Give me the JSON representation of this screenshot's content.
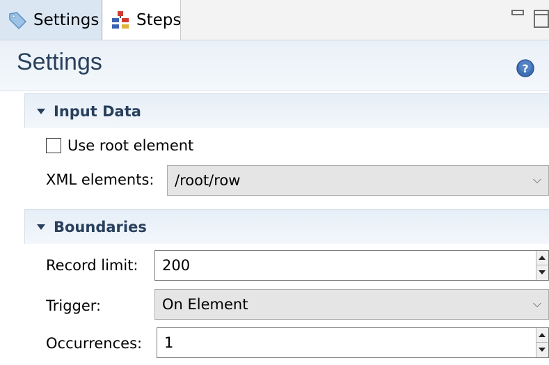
{
  "tabs": [
    {
      "label": "Settings",
      "icon": "tag-icon",
      "active": true
    },
    {
      "label": "Steps",
      "icon": "steps-icon",
      "active": false
    }
  ],
  "header": {
    "title": "Settings",
    "help_icon": "help-icon"
  },
  "input_data": {
    "title": "Input Data",
    "use_root_label": "Use root element",
    "use_root_checked": false,
    "xml_label": "XML elements:",
    "xml_value": "/root/row"
  },
  "boundaries": {
    "title": "Boundaries",
    "record_limit_label": "Record limit:",
    "record_limit_value": "200",
    "trigger_label": "Trigger:",
    "trigger_value": "On Element",
    "occurrences_label": "Occurrences:",
    "occurrences_value": "1"
  },
  "colors": {
    "accent": "#29405c",
    "active_tab": "#dae7f3"
  }
}
